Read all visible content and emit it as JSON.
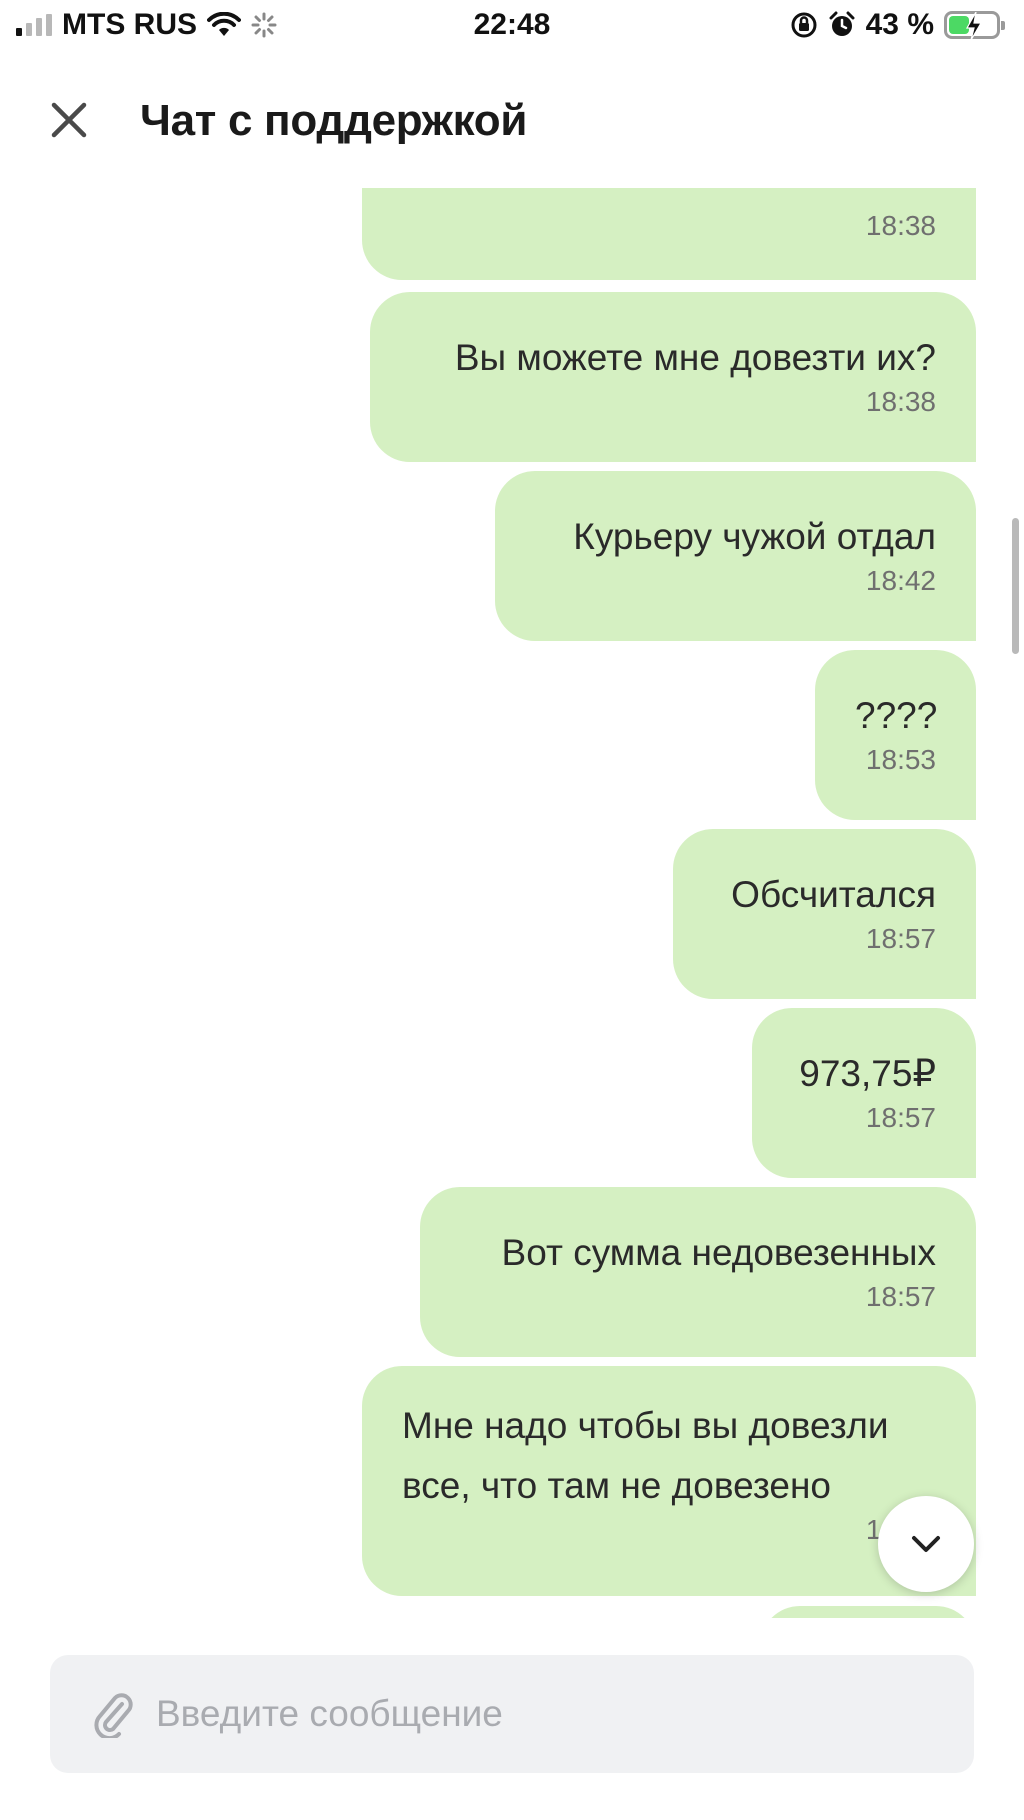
{
  "status_bar": {
    "carrier": "MTS RUS",
    "time": "22:48",
    "battery_percent": "43 %",
    "battery_level": 0.43,
    "icons": [
      "signal-icon",
      "wifi-icon",
      "loading-icon",
      "orientation-lock-icon",
      "alarm-icon",
      "battery-charging-icon"
    ]
  },
  "header": {
    "title": "Чат с поддержкой",
    "close_icon": "close-icon"
  },
  "messages": [
    {
      "text": "",
      "time": "18:38",
      "partial": "top"
    },
    {
      "text": "Вы можете мне довезти их?",
      "time": "18:38"
    },
    {
      "text": "Курьеру чужой отдал",
      "time": "18:42"
    },
    {
      "text": "????",
      "time": "18:53"
    },
    {
      "text": "Обсчитался",
      "time": "18:57"
    },
    {
      "text": "973,75₽",
      "time": "18:57"
    },
    {
      "text": "Вот сумма недовезенных",
      "time": "18:57"
    },
    {
      "text": "Мне надо чтобы вы довезли\nвсе, что там не довезено",
      "time": "18:57"
    }
  ],
  "scroll_down_icon": "chevron-down-icon",
  "composer": {
    "placeholder": "Введите сообщение",
    "value": "",
    "attach_icon": "paperclip-icon"
  },
  "colors": {
    "bubble": "#d5f0c2",
    "input_bg": "#f0f1f3",
    "placeholder": "#a9abb0"
  }
}
